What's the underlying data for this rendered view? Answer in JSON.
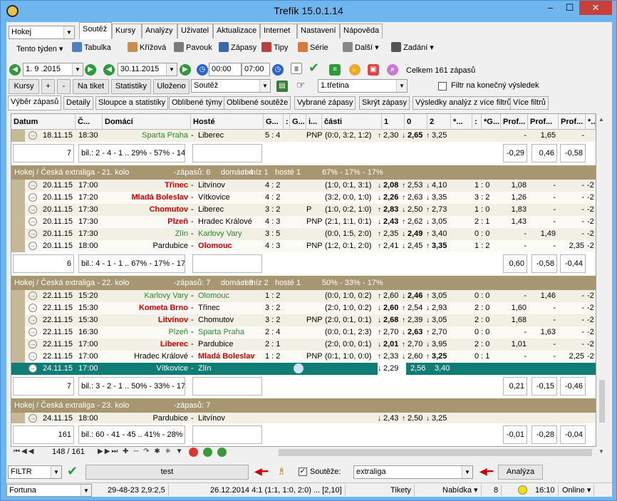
{
  "window": {
    "title": "Trefík 15.0.1.14",
    "min": "‒",
    "max": "☐",
    "close": "✕"
  },
  "sport_select": "Hokej",
  "period_menu": "Tento týden ▾",
  "tabs": [
    "Soutěž",
    "Kursy",
    "Analýzy",
    "Uživatel",
    "Aktualizace",
    "Internet",
    "Nastavení",
    "Nápověda"
  ],
  "toolbar": {
    "tabulka": "Tabulka",
    "krizova": "Křížová",
    "pavouk": "Pavouk",
    "zapasy": "Zápasy",
    "tipy": "Tipy",
    "serie": "Série",
    "dalsi": "Další ▾",
    "zadani": "Zadání ▾"
  },
  "filterbar": {
    "date_from": "1. 9 .2015",
    "date_to": "30.11.2015",
    "time_from": "00:00",
    "time_to": "07:00",
    "total": "Celkem 161 zápasů"
  },
  "bar3": {
    "kursy": "Kursy",
    "plus": "+",
    "minus": "-",
    "na_tiket": "Na tiket",
    "statistiky": "Statistiky",
    "ulozeno": "Uloženo",
    "soutez": "Soutěž",
    "tretina": "1.třetina",
    "filtr_label": "Filtr na konečný výsledek"
  },
  "subtabs": [
    "Výběr zápasů",
    "Detaily",
    "Sloupce a statistiky",
    "Oblíbené týmy",
    "Oblíbené soutěže",
    "Vybrané zápasy",
    "Skrýt zápasy",
    "Výsledky analýz z více filtrů",
    "Více filtrů"
  ],
  "columns": [
    "Datum",
    "Č...",
    "Domácí",
    "Hosté",
    "G...",
    ":",
    "G...",
    "i...",
    "části",
    "1",
    "0",
    "2",
    "*...",
    ":",
    "*G...",
    "Prof...",
    "Prof...",
    "Prof...",
    "*..."
  ],
  "top_row": {
    "date": "18.11.15",
    "time": "18:30",
    "home": "Sparta Praha",
    "away": "Liberec",
    "score": "5 : 4",
    "extra": "PNP",
    "parts": "(0:0, 3:2, 1:2)",
    "o1": "2,30",
    "o0": "2,65",
    "o2": "3,25",
    "p1": "-",
    "p2": "1,65",
    "p3": "-"
  },
  "summary0": {
    "count": "7",
    "stats": "bil.: 2 - 4 - 1 .. 29% - 57% - 14",
    "p1": "-0,29",
    "p2": "0,46",
    "p3": "-0,58"
  },
  "groups": [
    {
      "title": "Hokej / Česká extraliga - 21. kolo",
      "info1": "-zápasů: 6",
      "info2": "domácí 4",
      "info3": "remíz 1",
      "info4": "hosté 1",
      "info5": "67% - 17% - 17%",
      "rows": [
        {
          "date": "20.11.15",
          "time": "17:00",
          "home": "Třinec",
          "away": "Litvínov",
          "score": "4 : 2",
          "extra": "",
          "parts": "(1:0, 0:1, 3:1)",
          "o1": "2,08",
          "o0": "2,53",
          "o2": "4,10",
          "half": "1 : 0",
          "p1": "1,08",
          "p2": "-",
          "p3": "-",
          "last": "-2"
        },
        {
          "date": "20.11.15",
          "time": "17:20",
          "home": "Mladá Boleslav",
          "away": "Vítkovice",
          "score": "4 : 2",
          "extra": "",
          "parts": "(3:2, 0:0, 1:0)",
          "o1": "2,26",
          "o0": "2,63",
          "o2": "3,35",
          "half": "3 : 2",
          "p1": "1,26",
          "p2": "-",
          "p3": "-",
          "last": "-2"
        },
        {
          "date": "20.11.15",
          "time": "17:30",
          "home": "Chomutov",
          "away": "Liberec",
          "score": "3 : 2",
          "extra": "P",
          "parts": "(1:0, 0:2, 1:0)",
          "o1": "2,83",
          "o0": "2,50",
          "o2": "2,73",
          "half": "1 : 0",
          "p1": "1,83",
          "p2": "-",
          "p3": "-",
          "last": "-2"
        },
        {
          "date": "20.11.15",
          "time": "17:30",
          "home": "Plzeň",
          "away": "Hradec Králové",
          "score": "4 : 3",
          "extra": "PNP",
          "parts": "(2:1, 1:1, 0:1)",
          "o1": "2,43",
          "o0": "2,62",
          "o2": "3,05",
          "half": "2 : 1",
          "p1": "1,43",
          "p2": "-",
          "p3": "-",
          "last": "-2"
        },
        {
          "date": "20.11.15",
          "time": "17:30",
          "home": "Zlín",
          "away": "Karlovy Vary",
          "score": "3 : 5",
          "extra": "",
          "parts": "(0:0, 1:5, 2:0)",
          "o1": "2,35",
          "o0": "2,49",
          "o2": "3,40",
          "half": "0 : 0",
          "p1": "-",
          "p2": "1,49",
          "p3": "-",
          "last": "-2"
        },
        {
          "date": "20.11.15",
          "time": "18:00",
          "home": "Pardubice",
          "away": "Olomouc",
          "score": "4 : 3",
          "extra": "PNP",
          "parts": "(1:2, 0:1, 2:0)",
          "o1": "2,41",
          "o0": "2,45",
          "o2": "3,35",
          "half": "1 : 2",
          "p1": "-",
          "p2": "-",
          "p3": "2,35",
          "last": "-2"
        }
      ],
      "summary": {
        "count": "6",
        "stats": "bil.: 4 - 1 - 1 .. 67% - 17% - 17",
        "p1": "0,60",
        "p2": "-0,58",
        "p3": "-0,44"
      }
    },
    {
      "title": "Hokej / Česká extraliga - 22. kolo",
      "info1": "-zápasů: 7",
      "info2": "domácí 3",
      "info3": "remíz 2",
      "info4": "hosté 1",
      "info5": "50% - 33% - 17%",
      "rows": [
        {
          "date": "22.11.15",
          "time": "15:20",
          "home": "Karlovy Vary",
          "away": "Olomouc",
          "score": "1 : 2",
          "extra": "",
          "parts": "(0:0, 1:0, 0:2)",
          "o1": "2,60",
          "o0": "2,46",
          "o2": "3,05",
          "half": "0 : 0",
          "p1": "-",
          "p2": "1,46",
          "p3": "-",
          "last": "-2"
        },
        {
          "date": "22.11.15",
          "time": "15:30",
          "home": "Kometa Brno",
          "away": "Třinec",
          "score": "3 : 2",
          "extra": "",
          "parts": "(2:0, 1:0, 0:2)",
          "o1": "2,60",
          "o0": "2,54",
          "o2": "2,93",
          "half": "2 : 0",
          "p1": "1,60",
          "p2": "-",
          "p3": "-",
          "last": "-2"
        },
        {
          "date": "22.11.15",
          "time": "15:30",
          "home": "Litvínov",
          "away": "Chomutov",
          "score": "3 : 2",
          "extra": "PNP",
          "parts": "(2:0, 0:1, 0:1)",
          "o1": "2,68",
          "o0": "2,39",
          "o2": "3,05",
          "half": "2 : 0",
          "p1": "1,68",
          "p2": "-",
          "p3": "-",
          "last": "-2"
        },
        {
          "date": "22.11.15",
          "time": "16:30",
          "home": "Plzeň",
          "away": "Sparta Praha",
          "score": "2 : 4",
          "extra": "",
          "parts": "(0:0, 0:1, 2:3)",
          "o1": "2,70",
          "o0": "2,63",
          "o2": "2,70",
          "half": "0 : 0",
          "p1": "-",
          "p2": "1,63",
          "p3": "-",
          "last": "-2"
        },
        {
          "date": "22.11.15",
          "time": "17:00",
          "home": "Liberec",
          "away": "Pardubice",
          "score": "2 : 1",
          "extra": "",
          "parts": "(2:0, 0:0, 0:1)",
          "o1": "2,01",
          "o0": "2,70",
          "o2": "3,95",
          "half": "2 : 0",
          "p1": "1,01",
          "p2": "-",
          "p3": "-",
          "last": "-2"
        },
        {
          "date": "22.11.15",
          "time": "17:00",
          "home": "Hradec Králové",
          "away": "Mladá Boleslav",
          "score": "1 : 2",
          "extra": "PNP",
          "parts": "(0:1, 1:0, 0:0)",
          "o1": "2,33",
          "o0": "2,60",
          "o2": "3,25",
          "half": "0 : 1",
          "p1": "-",
          "p2": "-",
          "p3": "2,25",
          "last": "-2"
        }
      ],
      "selected": {
        "date": "24.11.15",
        "time": "17:00",
        "home": "Vítkovice",
        "away": "Zlín",
        "o1": "2,29",
        "o0": "2,56",
        "o2": "3,40"
      },
      "summary": {
        "count": "7",
        "stats": "bil.: 3 - 2 - 1 .. 50% - 33% - 17",
        "p1": "0,21",
        "p2": "-0,15",
        "p3": "-0,46"
      }
    },
    {
      "title": "Hokej / Česká extraliga - 23. kolo",
      "info1": "-zápasů: 7",
      "rows": [
        {
          "date": "24.11.15",
          "time": "18:00",
          "home": "Pardubice",
          "away": "Litvínov",
          "o1": "2,43",
          "o0": "2,50",
          "o2": "3,25"
        }
      ]
    }
  ],
  "total_summary": {
    "count": "161",
    "stats": "bil.: 60 - 41 - 45 .. 41% - 28%",
    "p1": "-0,01",
    "p2": "-0,28",
    "p3": "-0,04"
  },
  "navigator": {
    "position": "148 / 161"
  },
  "bottom": {
    "filtr": "FILTR",
    "test": "test",
    "souteze_label": "Soutěže:",
    "souteze_value": "extraliga",
    "analyza": "Analýza"
  },
  "status": {
    "league": "Fortuna",
    "s1": "29-48-23  2,9:2,5",
    "s2": "26.12.2014 4:1 (1:1, 1:0, 2:0) ... [2,10]",
    "tikety": "Tikety",
    "nabidka": "Nabídka ▾",
    "num": "8",
    "time": "16:10",
    "online": "Online ▾"
  },
  "colors": {
    "group_bg": "#a89670",
    "selected_row": "#0f7d75",
    "title_bar": "#6fb6ee",
    "winner": "#cc0000",
    "green_team": "#2a8a2a"
  }
}
